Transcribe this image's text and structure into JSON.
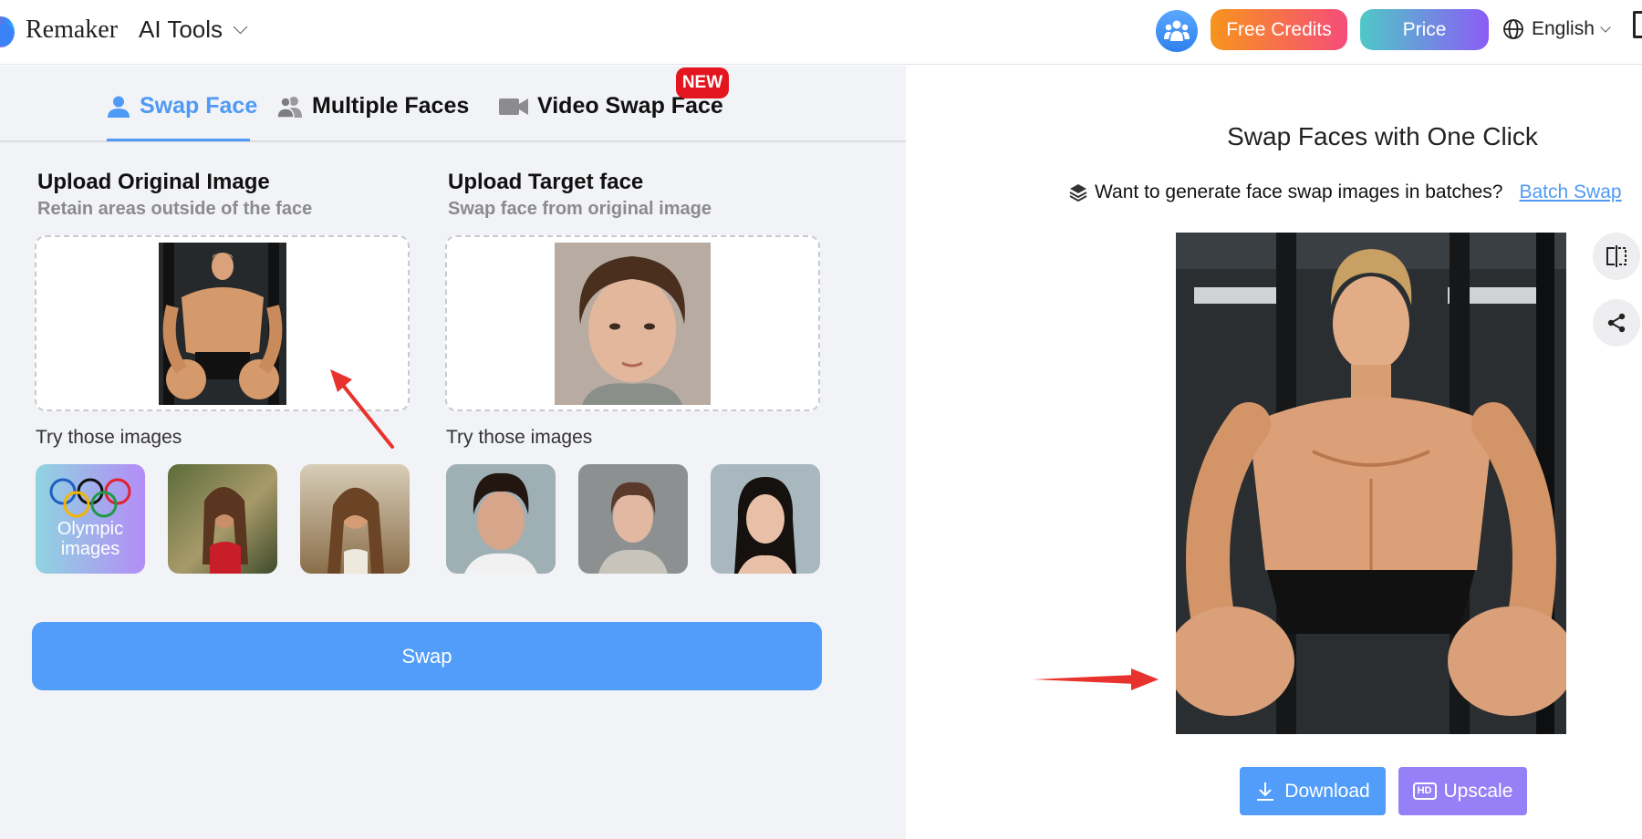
{
  "header": {
    "brand": "Remaker",
    "ai_tools_label": "AI Tools",
    "community_icon": "community-icon",
    "free_credits_label": "Free Credits",
    "price_label": "Price",
    "language_label": "English",
    "colors": {
      "free_credits_from": "#f7941d",
      "free_credits_to": "#f54d7a",
      "price_from": "#4fc8c7",
      "price_to": "#8b5cf6"
    }
  },
  "tabs": [
    {
      "label": "Swap Face",
      "icon": "user-icon",
      "active": true
    },
    {
      "label": "Multiple Faces",
      "icon": "users-icon",
      "active": false
    },
    {
      "label": "Video Swap Face",
      "icon": "video-icon",
      "active": false,
      "badge": "NEW"
    }
  ],
  "upload": {
    "original": {
      "title": "Upload Original Image",
      "subtitle": "Retain areas outside of the face"
    },
    "target": {
      "title": "Upload Target face",
      "subtitle": "Swap face from original image"
    }
  },
  "samples": {
    "label": "Try those images",
    "original": [
      {
        "kind": "olympic",
        "caption": "Olympic images"
      },
      {
        "kind": "photo",
        "caption": ""
      },
      {
        "kind": "photo",
        "caption": ""
      }
    ],
    "target": [
      {
        "kind": "photo",
        "caption": ""
      },
      {
        "kind": "photo",
        "caption": ""
      },
      {
        "kind": "photo",
        "caption": ""
      }
    ]
  },
  "swap_button": "Swap",
  "result": {
    "title": "Swap Faces with One Click",
    "batch_prompt": "Want to generate face swap images in batches?",
    "batch_link": "Batch Swap",
    "download_label": "Download",
    "upscale_label": "Upscale",
    "hd_badge": "HD"
  },
  "accent": "#519df9",
  "annotation_color": "#e8322e"
}
